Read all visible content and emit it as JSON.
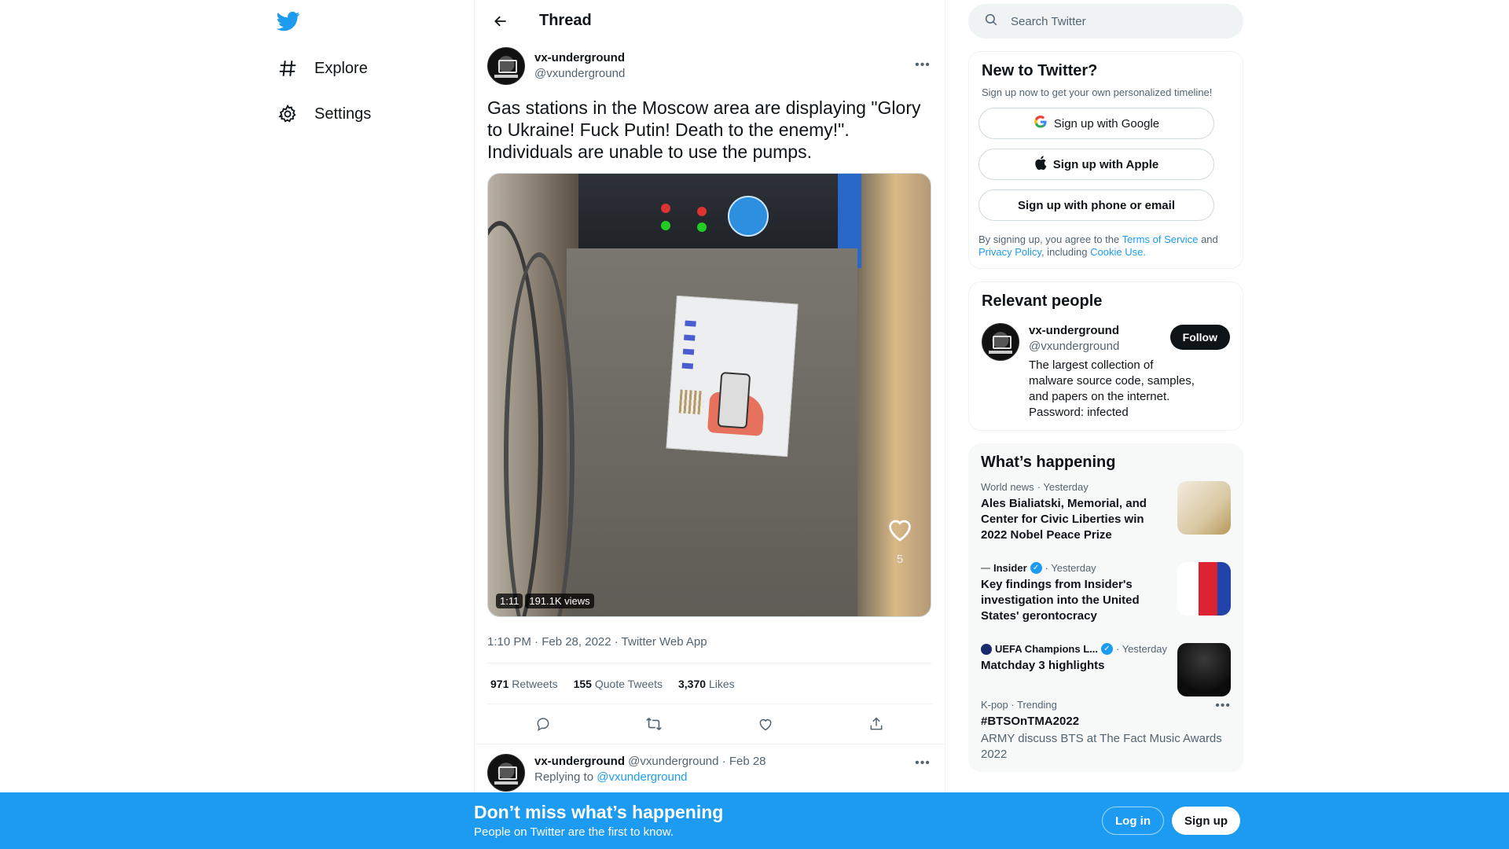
{
  "nav": {
    "items": [
      {
        "label": "Explore",
        "icon": "hashtag-icon"
      },
      {
        "label": "Settings",
        "icon": "gear-icon"
      }
    ]
  },
  "header": {
    "title": "Thread"
  },
  "tweet": {
    "author_name": "vx-underground",
    "author_handle": "@vxunderground",
    "text": "Gas stations in the Moscow area are displaying \"Glory to Ukraine! Fuck Putin! Death to the enemy!\". Individuals are unable to use the pumps.",
    "video_duration": "1:11",
    "video_views": "191.1K views",
    "overlay_like_count": "5",
    "timestamp": "1:10 PM · Feb 28, 2022 · Twitter Web App",
    "stats": {
      "retweets_count": "971",
      "retweets_label": "Retweets",
      "quotes_count": "155",
      "quotes_label": "Quote Tweets",
      "likes_count": "3,370",
      "likes_label": "Likes"
    }
  },
  "reply": {
    "author_name": "vx-underground",
    "author_handle": "@vxunderground",
    "date": "· Feb 28",
    "replying_prefix": "Replying to",
    "replying_handle": "@vxunderground"
  },
  "search": {
    "placeholder": "Search Twitter"
  },
  "signup_card": {
    "title": "New to Twitter?",
    "subtitle": "Sign up now to get your own personalized timeline!",
    "google": "Sign up with Google",
    "apple": "Sign up with Apple",
    "phone": "Sign up with phone or email",
    "legal_prefix": "By signing up, you agree to the",
    "terms": "Terms of Service",
    "and": "and",
    "privacy": "Privacy Policy",
    "including": ", including",
    "cookie": "Cookie Use."
  },
  "relevant": {
    "title": "Relevant people",
    "name": "vx-underground",
    "handle": "@vxunderground",
    "follow": "Follow",
    "bio": "The largest collection of malware source code, samples, and papers on the internet. Password: infected"
  },
  "happening": {
    "title": "What’s happening",
    "trends": [
      {
        "source": "World news",
        "time": "· Yesterday",
        "headline": "Ales Bialiatski, Memorial, and Center for Civic Liberties win 2022 Nobel Peace Prize"
      },
      {
        "source": "Insider",
        "time": "· Yesterday",
        "headline": "Key findings from Insider's investigation into the United States' gerontocracy"
      },
      {
        "source": "UEFA Champions L...",
        "time": "· Yesterday",
        "headline": "Matchday 3 highlights"
      },
      {
        "source": "K-pop · Trending",
        "headline": "#BTSOnTMA2022",
        "desc": "ARMY discuss BTS at The Fact Music Awards 2022"
      }
    ]
  },
  "banner": {
    "title": "Don’t miss what’s happening",
    "subtitle": "People on Twitter are the first to know.",
    "login": "Log in",
    "signup": "Sign up"
  },
  "colors": {
    "accent": "#1d9bf0",
    "text": "#0f1419",
    "muted": "#536471"
  }
}
